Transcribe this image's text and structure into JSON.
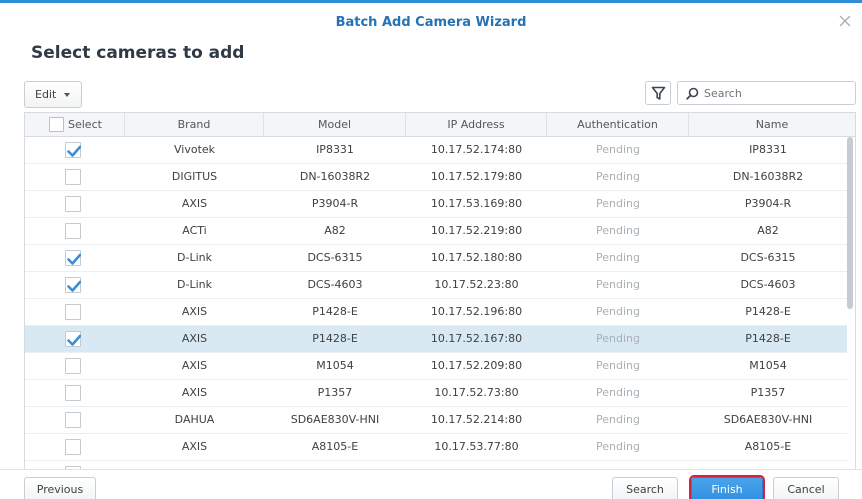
{
  "window": {
    "title": "Batch Add Camera Wizard"
  },
  "heading": "Select cameras to add",
  "toolbar": {
    "edit_label": "Edit",
    "search_placeholder": "Search"
  },
  "columns": [
    "Select",
    "Brand",
    "Model",
    "IP Address",
    "Authentication",
    "Name"
  ],
  "rows": [
    {
      "checked": true,
      "brand": "Vivotek",
      "model": "IP8331",
      "ip": "10.17.52.174:80",
      "auth": "Pending",
      "name": "IP8331"
    },
    {
      "checked": false,
      "brand": "DIGITUS",
      "model": "DN-16038R2",
      "ip": "10.17.52.179:80",
      "auth": "Pending",
      "name": "DN-16038R2"
    },
    {
      "checked": false,
      "brand": "AXIS",
      "model": "P3904-R",
      "ip": "10.17.53.169:80",
      "auth": "Pending",
      "name": "P3904-R"
    },
    {
      "checked": false,
      "brand": "ACTi",
      "model": "A82",
      "ip": "10.17.52.219:80",
      "auth": "Pending",
      "name": "A82"
    },
    {
      "checked": true,
      "brand": "D-Link",
      "model": "DCS-6315",
      "ip": "10.17.52.180:80",
      "auth": "Pending",
      "name": "DCS-6315"
    },
    {
      "checked": true,
      "brand": "D-Link",
      "model": "DCS-4603",
      "ip": "10.17.52.23:80",
      "auth": "Pending",
      "name": "DCS-4603"
    },
    {
      "checked": false,
      "brand": "AXIS",
      "model": "P1428-E",
      "ip": "10.17.52.196:80",
      "auth": "Pending",
      "name": "P1428-E"
    },
    {
      "checked": true,
      "brand": "AXIS",
      "model": "P1428-E",
      "ip": "10.17.52.167:80",
      "auth": "Pending",
      "name": "P1428-E"
    },
    {
      "checked": false,
      "brand": "AXIS",
      "model": "M1054",
      "ip": "10.17.52.209:80",
      "auth": "Pending",
      "name": "M1054"
    },
    {
      "checked": false,
      "brand": "AXIS",
      "model": "P1357",
      "ip": "10.17.52.73:80",
      "auth": "Pending",
      "name": "P1357"
    },
    {
      "checked": false,
      "brand": "DAHUA",
      "model": "SD6AE830V-HNI",
      "ip": "10.17.52.214:80",
      "auth": "Pending",
      "name": "SD6AE830V-HNI"
    },
    {
      "checked": false,
      "brand": "AXIS",
      "model": "A8105-E",
      "ip": "10.17.53.77:80",
      "auth": "Pending",
      "name": "A8105-E"
    }
  ],
  "highlighted_row": 7,
  "footer": {
    "previous": "Previous",
    "search": "Search",
    "finish": "Finish",
    "cancel": "Cancel"
  },
  "colors": {
    "accent": "#2c8fd8",
    "title": "#2572b4",
    "finish_highlight": "#d9213f",
    "row_highlight": "#d9e9f3",
    "check": "#3a8fd6"
  },
  "icons": {
    "close": "close-icon",
    "filter": "filter-icon",
    "search": "search-icon",
    "check": "check-icon",
    "caret": "caret-down-icon"
  }
}
